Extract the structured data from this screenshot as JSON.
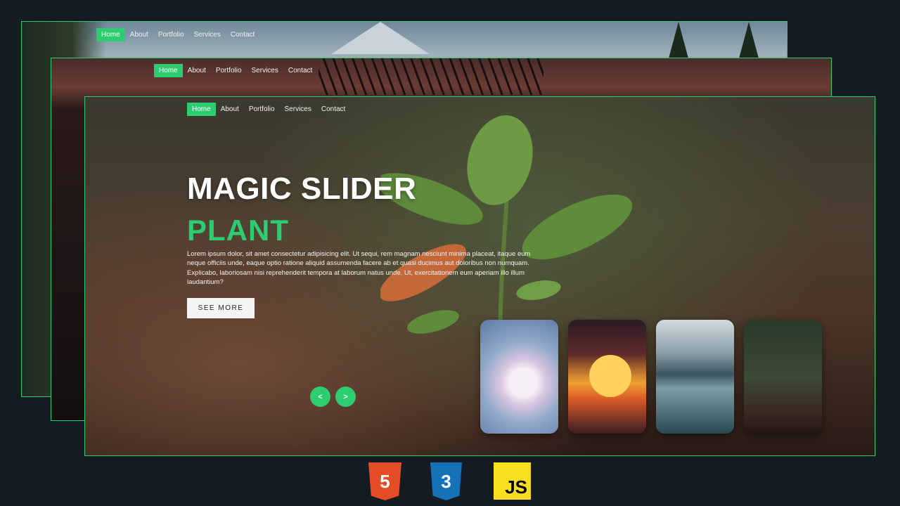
{
  "slides": [
    {
      "nav": [
        "Home",
        "About",
        "Portfolio",
        "Services",
        "Contact"
      ],
      "active": "Home"
    },
    {
      "nav": [
        "Home",
        "About",
        "Portfolio",
        "Services",
        "Contact"
      ],
      "active": "Home"
    },
    {
      "nav": [
        "Home",
        "About",
        "Portfolio",
        "Services",
        "Contact"
      ],
      "active": "Home"
    }
  ],
  "hero": {
    "title": "MAGIC SLIDER",
    "subtitle": "PLANT",
    "description": "Lorem ipsum dolor, sit amet consectetur adipisicing elit. Ut sequi, rem magnam nesciunt minima placeat, itaque eum neque officiis unde, eaque optio ratione aliquid assumenda facere ab et quasi ducimus aut doloribus non numquam. Explicabo, laboriosam nisi reprehenderit tempora at laborum natus unde. Ut, exercitationem eum aperiam illo illum laudantium?",
    "button_label": "SEE MORE"
  },
  "controls": {
    "prev": "<",
    "next": ">"
  },
  "thumbnails": [
    "flower",
    "sunset-tree",
    "mountain-lake",
    "plant"
  ],
  "tech_logos": [
    {
      "name": "html5-icon",
      "label": "5"
    },
    {
      "name": "css3-icon",
      "label": "3"
    },
    {
      "name": "javascript-icon",
      "label": "JS"
    }
  ],
  "colors": {
    "accent": "#2ecc71",
    "background": "#141b22"
  }
}
